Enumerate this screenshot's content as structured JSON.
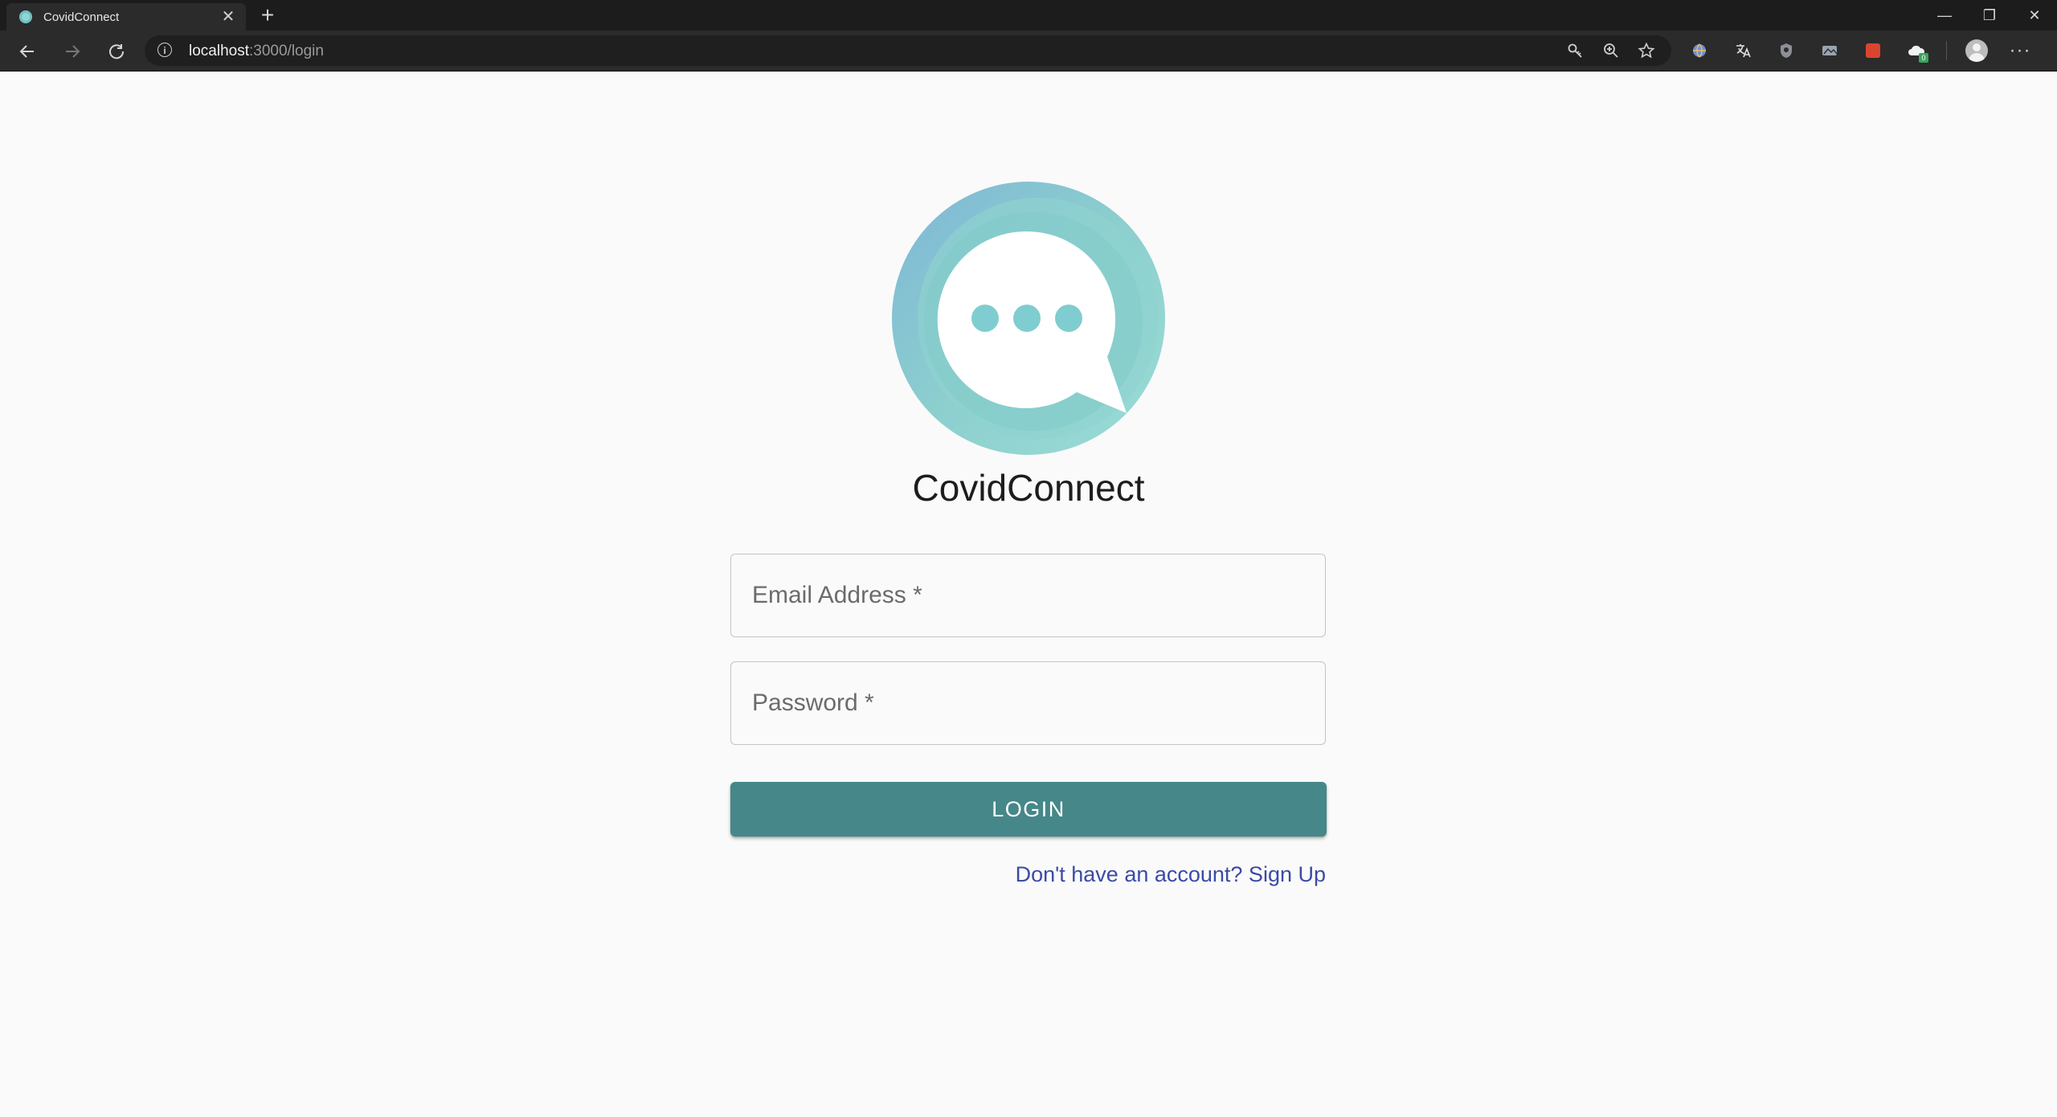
{
  "browser": {
    "tab_title": "CovidConnect",
    "tab_close": "✕",
    "new_tab": "+",
    "window_controls": {
      "minimize": "—",
      "restore": "❐",
      "close": "✕"
    },
    "url_host": "localhost",
    "url_path": ":3000/login",
    "info_icon": "i",
    "more_menu": "···"
  },
  "page": {
    "app_title": "CovidConnect",
    "email_placeholder": "Email Address *",
    "password_placeholder": "Password *",
    "login_label": "LOGIN",
    "signup_link": "Don't have an account? Sign Up"
  },
  "colors": {
    "accent": "#468789",
    "logo_teal": "#8fd3d0",
    "link": "#3b4ba6",
    "background": "#fafafa"
  }
}
